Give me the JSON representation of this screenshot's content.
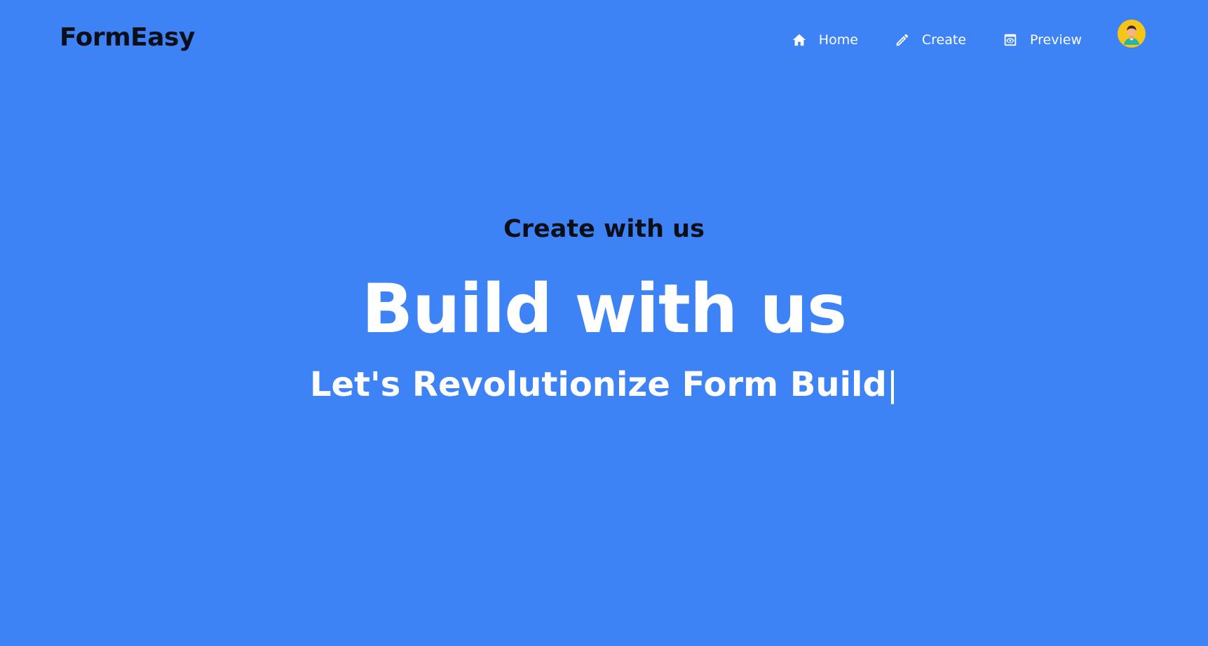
{
  "header": {
    "brand": "FormEasy",
    "nav": [
      {
        "label": "Home",
        "icon": "home-icon"
      },
      {
        "label": "Create",
        "icon": "pencil-icon"
      },
      {
        "label": "Preview",
        "icon": "preview-icon"
      }
    ],
    "avatar_icon": "user-avatar-icon"
  },
  "hero": {
    "kicker": "Create with us",
    "title": "Build with us",
    "typing_text": "Let's Revolutionize Form Build",
    "cursor": "|"
  },
  "colors": {
    "background": "#3e83f6",
    "brand_text": "#0b0f19",
    "nav_text": "#ffffff",
    "avatar_bg": "#f5c518"
  }
}
